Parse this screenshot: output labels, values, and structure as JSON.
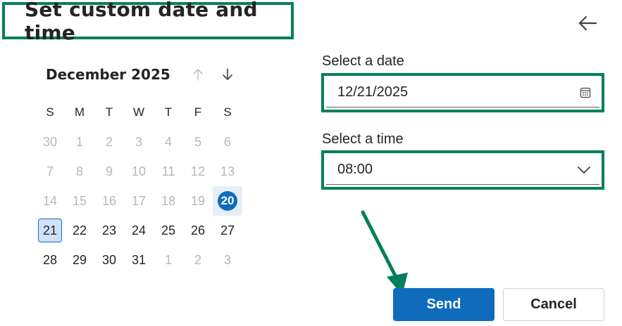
{
  "dialog": {
    "title": "Set custom date and time",
    "back_icon": "arrow-left-icon"
  },
  "calendar": {
    "month_label": "December 2025",
    "nav": {
      "up_icon": "arrow-up-icon",
      "down_icon": "arrow-down-icon"
    },
    "weekdays": [
      "S",
      "M",
      "T",
      "W",
      "T",
      "F",
      "S"
    ],
    "weeks": [
      [
        {
          "d": "30",
          "state": "muted"
        },
        {
          "d": "1",
          "state": "muted"
        },
        {
          "d": "2",
          "state": "muted"
        },
        {
          "d": "3",
          "state": "muted"
        },
        {
          "d": "4",
          "state": "muted"
        },
        {
          "d": "5",
          "state": "muted"
        },
        {
          "d": "6",
          "state": "muted"
        }
      ],
      [
        {
          "d": "7",
          "state": "muted"
        },
        {
          "d": "8",
          "state": "muted"
        },
        {
          "d": "9",
          "state": "muted"
        },
        {
          "d": "10",
          "state": "muted"
        },
        {
          "d": "11",
          "state": "muted"
        },
        {
          "d": "12",
          "state": "muted"
        },
        {
          "d": "13",
          "state": "muted"
        }
      ],
      [
        {
          "d": "14",
          "state": "muted"
        },
        {
          "d": "15",
          "state": "muted"
        },
        {
          "d": "16",
          "state": "muted"
        },
        {
          "d": "17",
          "state": "muted"
        },
        {
          "d": "18",
          "state": "muted"
        },
        {
          "d": "19",
          "state": "muted"
        },
        {
          "d": "20",
          "state": "today"
        }
      ],
      [
        {
          "d": "21",
          "state": "selected"
        },
        {
          "d": "22",
          "state": "normal"
        },
        {
          "d": "23",
          "state": "normal"
        },
        {
          "d": "24",
          "state": "normal"
        },
        {
          "d": "25",
          "state": "normal"
        },
        {
          "d": "26",
          "state": "normal"
        },
        {
          "d": "27",
          "state": "normal"
        }
      ],
      [
        {
          "d": "28",
          "state": "normal"
        },
        {
          "d": "29",
          "state": "normal"
        },
        {
          "d": "30",
          "state": "normal"
        },
        {
          "d": "31",
          "state": "normal"
        },
        {
          "d": "1",
          "state": "muted"
        },
        {
          "d": "2",
          "state": "muted"
        },
        {
          "d": "3",
          "state": "muted"
        }
      ]
    ]
  },
  "date_field": {
    "label": "Select a date",
    "value": "12/21/2025",
    "icon": "calendar-icon"
  },
  "time_field": {
    "label": "Select a time",
    "value": "08:00",
    "icon": "chevron-down-icon"
  },
  "buttons": {
    "send_label": "Send",
    "cancel_label": "Cancel"
  },
  "colors": {
    "accent": "#0f6cbd",
    "annotation": "#00805a",
    "muted_text": "#b7b7b7"
  }
}
